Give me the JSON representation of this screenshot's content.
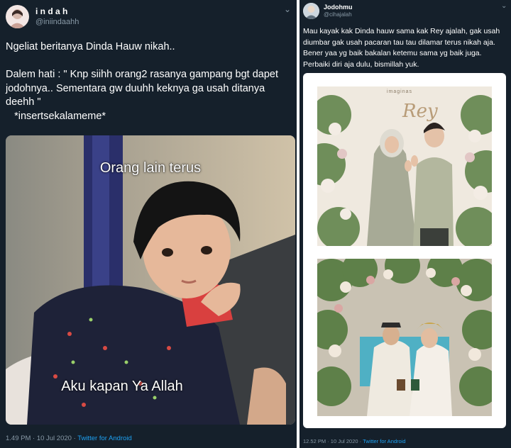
{
  "tweet1": {
    "name": "i n d a h",
    "handle": "@iniindaahh",
    "text": "Ngeliat beritanya Dinda Hauw nikah..\n\nDalem hati : \" Knp siihh orang2 rasanya gampang bgt dapet jodohnya.. Sementara gw duuhh keknya ga usah ditanya deehh \"\n   *insertsekalameme*",
    "meme_top": "Orang lain terus",
    "meme_bottom": "Aku kapan Ya Allah",
    "time": "1.49 PM · 10 Jul 2020 · ",
    "source": "Twitter for Android"
  },
  "tweet2": {
    "name": "Jodohmu",
    "handle": "@cihajalah",
    "text": "Mau kayak kak Dinda hauw sama kak Rey ajalah, gak usah diumbar gak usah pacaran tau tau dilamar terus nikah aja. Bener yaa yg baik bakalan ketemu sama yg baik juga. Perbaiki diri aja dulu, bismillah yuk.",
    "photo1_sign": "Rey",
    "photo1_brand": "imaginas",
    "time": "12.52 PM · 10 Jul 2020 · ",
    "source": "Twitter for Android"
  }
}
